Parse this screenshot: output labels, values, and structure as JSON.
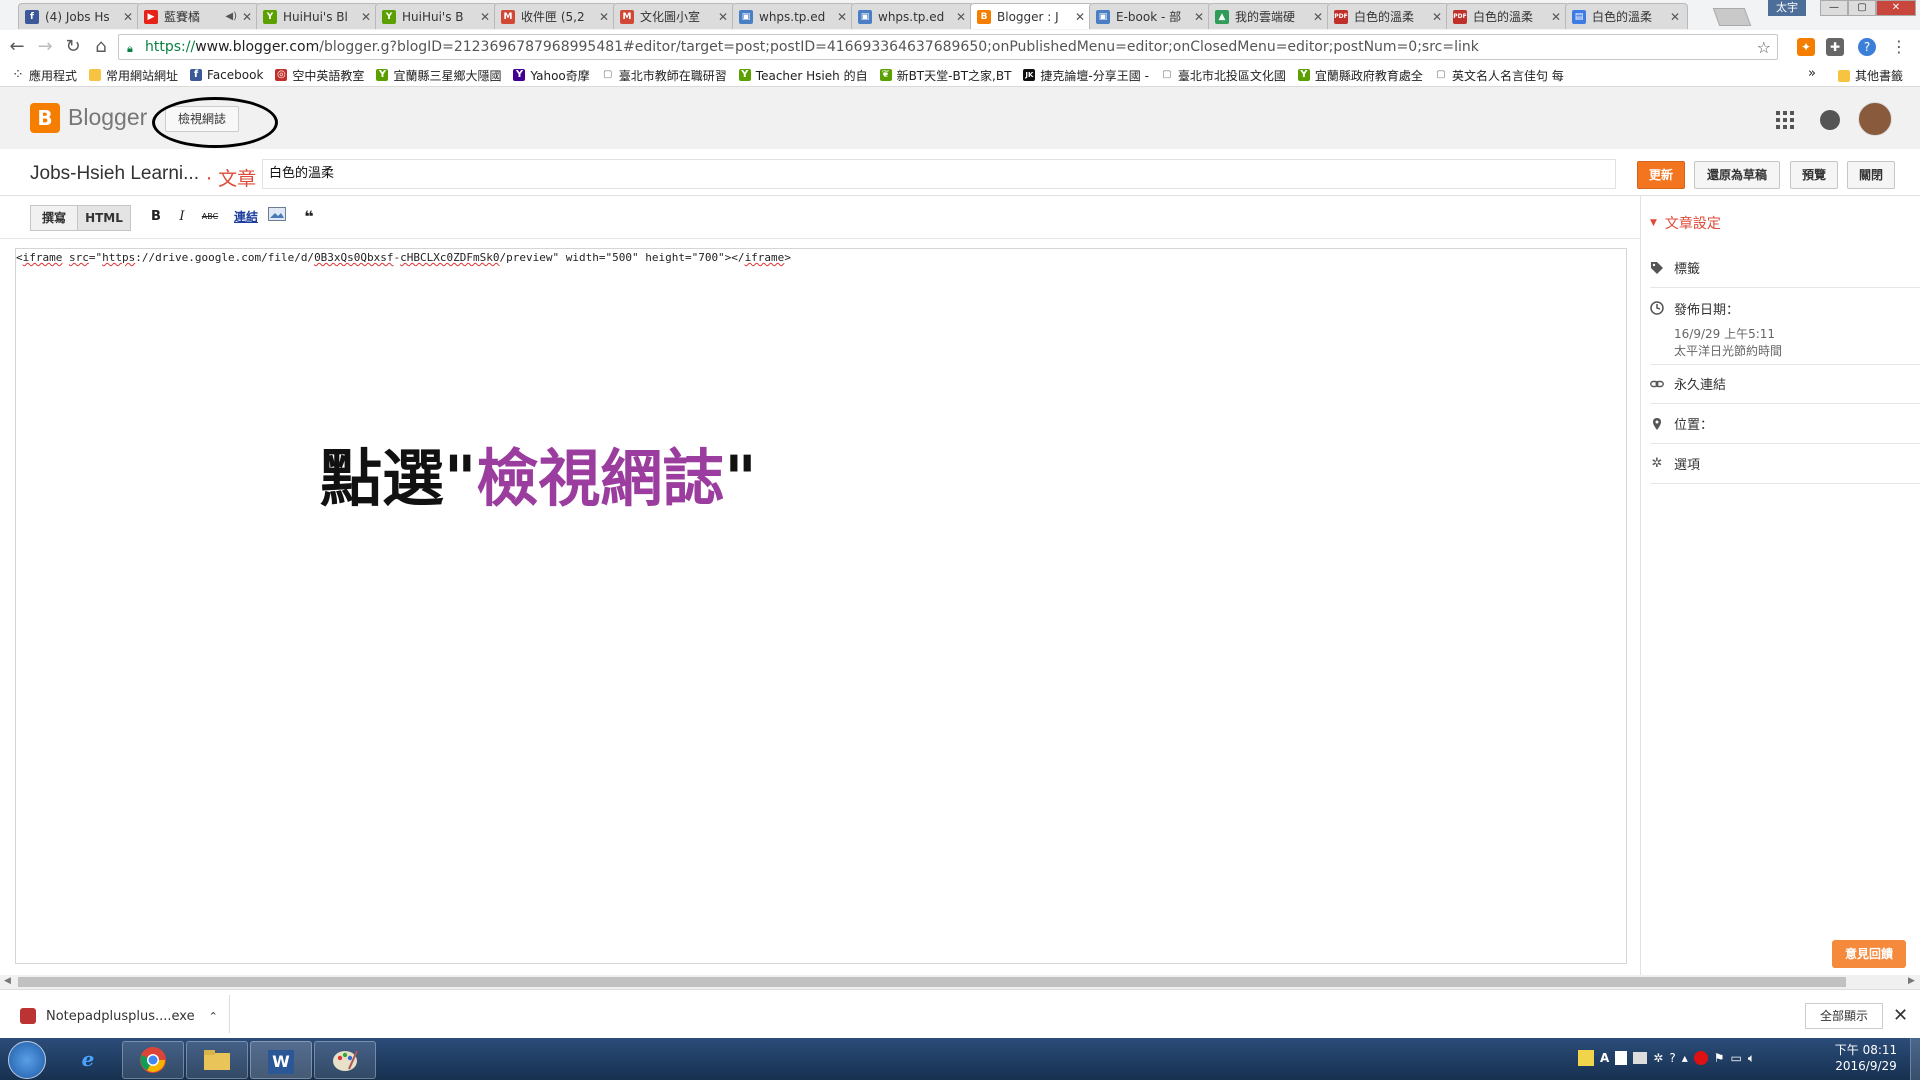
{
  "browser": {
    "tabs": [
      {
        "title": "(4) Jobs Hs",
        "fav": "facebook-icon",
        "color": "#3b5998",
        "glyph": "f"
      },
      {
        "title": "藍賽橘",
        "fav": "youtube-icon",
        "color": "#e62117",
        "glyph": "▶",
        "extra": "◀×"
      },
      {
        "title": "HuiHui's Bl",
        "fav": "hui-icon",
        "color": "#5aa000",
        "glyph": "Y"
      },
      {
        "title": "HuiHui's B",
        "fav": "hui-icon",
        "color": "#5aa000",
        "glyph": "Y"
      },
      {
        "title": "收件匣 (5,2",
        "fav": "gmail-icon",
        "color": "#d14836",
        "glyph": "M"
      },
      {
        "title": "文化圖小室",
        "fav": "gmail-icon",
        "color": "#d14836",
        "glyph": "M"
      },
      {
        "title": "whps.tp.ed",
        "fav": "page-icon",
        "color": "#4a7fc6",
        "glyph": "▣"
      },
      {
        "title": "whps.tp.ed",
        "fav": "page-icon",
        "color": "#4a7fc6",
        "glyph": "▣"
      },
      {
        "title": "Blogger : J",
        "fav": "blogger-icon",
        "color": "#f57d00",
        "glyph": "B",
        "active": true
      },
      {
        "title": "E-book - 部",
        "fav": "page-icon",
        "color": "#4a7fc6",
        "glyph": "▣"
      },
      {
        "title": "我的雲端硬",
        "fav": "drive-icon",
        "color": "#2f9d58",
        "glyph": "▲"
      },
      {
        "title": "白色的溫柔",
        "fav": "pdf-icon",
        "color": "#c0302b",
        "glyph": "PDF"
      },
      {
        "title": "白色的溫柔",
        "fav": "pdf-icon",
        "color": "#c0302b",
        "glyph": "PDF"
      },
      {
        "title": "白色的溫柔",
        "fav": "docs-icon",
        "color": "#3f7be5",
        "glyph": "▤"
      }
    ],
    "user_badge": "太宇",
    "url_secure": "https://",
    "url_host": "www.blogger.com",
    "url_rest": "/blogger.g?blogID=2123696787968995481#editor/target=post;postID=4166933646376896​50;onPublishedMenu=editor;onClosedMenu=editor;postNum=0;src=link",
    "bookmarks": [
      {
        "label": "應用程式",
        "icon": "apps-icon",
        "color": "#555",
        "glyph": "⁘"
      },
      {
        "label": "常用網站網址",
        "icon": "folder-icon",
        "color": "#f6c343",
        "glyph": ""
      },
      {
        "label": "Facebook",
        "icon": "facebook-icon",
        "color": "#3b5998",
        "glyph": "f"
      },
      {
        "label": "空中英語教室",
        "icon": "radio-icon",
        "color": "#c0302b",
        "glyph": "◎"
      },
      {
        "label": "宜蘭縣三星鄉大隱國",
        "icon": "hui-icon",
        "color": "#5aa000",
        "glyph": "Y"
      },
      {
        "label": "Yahoo奇摩",
        "icon": "yahoo-icon",
        "color": "#410093",
        "glyph": "Y"
      },
      {
        "label": "臺北市教師在職研習",
        "icon": "page-icon",
        "color": "#777",
        "glyph": "▢"
      },
      {
        "label": "Teacher Hsieh 的自",
        "icon": "hui-icon",
        "color": "#5aa000",
        "glyph": "Y"
      },
      {
        "label": "新BT天堂-BT之家,BT",
        "icon": "leaf-icon",
        "color": "#5aa000",
        "glyph": "❦"
      },
      {
        "label": "捷克論壇-分享王國 -",
        "icon": "jk-icon",
        "color": "#111",
        "glyph": "JK"
      },
      {
        "label": "臺北市北投區文化國",
        "icon": "page-icon",
        "color": "#777",
        "glyph": "▢"
      },
      {
        "label": "宜蘭縣政府教育處全",
        "icon": "hui-icon",
        "color": "#5aa000",
        "glyph": "Y"
      },
      {
        "label": "英文名人名言佳句 每",
        "icon": "page-icon",
        "color": "#777",
        "glyph": "▢"
      }
    ],
    "bookmarks_more": "»",
    "other_bookmarks": "其他書籤"
  },
  "blogger": {
    "brand": "Blogger",
    "view_blog": "檢視網誌",
    "blog_title": "Jobs-Hsieh Learni...",
    "breadcrumb": "· 文章",
    "post_title": "白色的溫柔",
    "buttons": {
      "update": "更新",
      "revert": "還原為草稿",
      "preview": "預覽",
      "close": "關閉"
    },
    "modes": {
      "compose": "撰寫",
      "html": "HTML"
    },
    "tools": {
      "bold": "B",
      "italic": "I",
      "strike": "ABC",
      "link": "連結",
      "quote": "❝"
    },
    "code": {
      "p1": "<",
      "tag": "iframe",
      "p2": " ",
      "src": "src",
      "p3": "=\"",
      "url1": "https",
      "p4": "://drive.google.com/file/d/",
      "id1": "0B3xQs0Qbxsf",
      "p5": "-",
      "id2": "cHBCLXc0ZDFmSk0",
      "p6": "/preview\" width=\"500\" height=\"700\"></",
      "tag2": "iframe",
      "p7": ">"
    },
    "annotation_prefix": "點選\"",
    "annotation_highlight": "檢視網誌",
    "annotation_suffix": "\"",
    "sidebar": {
      "header": "文章設定",
      "labels": "標籤",
      "date_label": "發佈日期：",
      "date_value": "16/9/29 上午5:11",
      "timezone": "太平洋日光節約時間",
      "permalink": "永久連結",
      "location": "位置：",
      "options": "選項"
    },
    "feedback": "意見回饋"
  },
  "downloads": {
    "file": "Notepadplusplus....exe",
    "show_all": "全部顯示"
  },
  "taskbar": {
    "time": "下午 08:11",
    "date": "2016/9/29"
  }
}
